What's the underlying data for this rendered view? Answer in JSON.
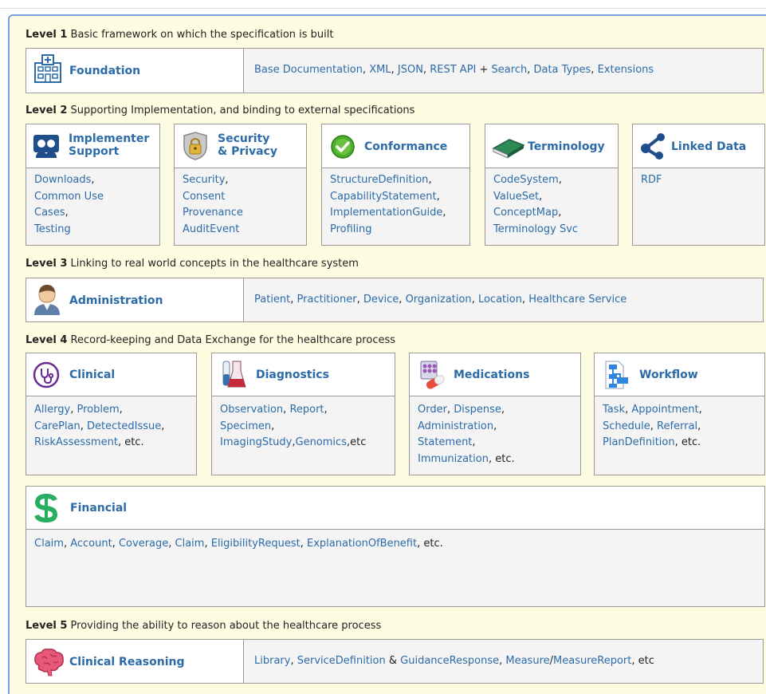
{
  "level1": {
    "num": "Level 1",
    "desc": " Basic framework on which the specification is built"
  },
  "foundation": {
    "title": "Foundation",
    "l1": "Base Documentation",
    "s1": ", ",
    "l2": "XML",
    "s2": ", ",
    "l3": "JSON",
    "s3": ", ",
    "l4": "REST API",
    "s4": " + ",
    "l5": "Search",
    "s5": ", ",
    "l6": "Data Types",
    "s6": ", ",
    "l7": "Extensions"
  },
  "level2": {
    "num": "Level 2",
    "desc": " Supporting Implementation, and binding to external specifications"
  },
  "implementer": {
    "title1": "Implementer",
    "title2": "Support",
    "l1": "Downloads",
    "s1": ",",
    "l2": "Common Use",
    "l3": "Cases",
    "s3": ",",
    "l4": "Testing"
  },
  "security": {
    "title1": "Security",
    "title2": "& Privacy",
    "l1": "Security",
    "s1": ",",
    "l2": "Consent",
    "l3": "Provenance",
    "l4": "AuditEvent"
  },
  "conformance": {
    "title": "Conformance",
    "l1": "StructureDefinition",
    "s1": ",",
    "l2": "CapabilityStatement",
    "s2": ",",
    "l3": "ImplementationGuide",
    "s3": ",",
    "l4": "Profiling"
  },
  "terminology": {
    "title": "Terminology",
    "l1": "CodeSystem",
    "s1": ",",
    "l2": "ValueSet",
    "s2": ",",
    "l3": "ConceptMap",
    "s3": ",",
    "l4": "Terminology Svc"
  },
  "linked": {
    "title": "Linked Data",
    "l1": "RDF"
  },
  "level3": {
    "num": "Level 3",
    "desc": " Linking to real world concepts in the healthcare system"
  },
  "administration": {
    "title": "Administration",
    "l1": "Patient",
    "s1": ", ",
    "l2": "Practitioner",
    "s2": ", ",
    "l3": "Device",
    "s3": ", ",
    "l4": "Organization",
    "s4": ", ",
    "l5": "Location",
    "s5": ", ",
    "l6": "Healthcare Service"
  },
  "level4": {
    "num": "Level 4",
    "desc": " Record-keeping and Data Exchange for the healthcare process"
  },
  "clinical": {
    "title": "Clinical",
    "l1": "Allergy",
    "s1": ", ",
    "l2": "Problem",
    "s2": ",",
    "l3": "CarePlan",
    "s3": ", ",
    "l4": "DetectedIssue",
    "s4": ",",
    "l5": "RiskAssessment",
    "s5": ", etc."
  },
  "diagnostics": {
    "title": "Diagnostics",
    "l1": "Observation",
    "s1": ", ",
    "l2": "Report",
    "s2": ",",
    "l3": "Specimen",
    "s3": ",",
    "l4": "ImagingStudy",
    "s4": ",",
    "l5": "Genomics",
    "s5": ",etc"
  },
  "medications": {
    "title": "Medications",
    "l1": "Order",
    "s1": ", ",
    "l2": "Dispense",
    "s2": ",",
    "l3": "Administration",
    "s3": ",",
    "l4": "Statement",
    "s4": ",",
    "l5": "Immunization",
    "s5": ", etc."
  },
  "workflow": {
    "title": "Workflow",
    "l1": "Task",
    "s1": ", ",
    "l2": "Appointment",
    "s2": ",",
    "l3": "Schedule",
    "s3": ", ",
    "l4": "Referral",
    "s4": ",",
    "l5": "PlanDefinition",
    "s5": ", etc."
  },
  "financial": {
    "title": "Financial",
    "l1": "Claim",
    "s1": ", ",
    "l2": "Account",
    "s2": ", ",
    "l3": "Coverage",
    "s3": ", ",
    "l4": "Claim",
    "s4": ", ",
    "l5": "EligibilityRequest",
    "s5": ", ",
    "l6": "ExplanationOfBenefit",
    "s6": ", etc."
  },
  "level5": {
    "num": "Level 5",
    "desc": " Providing the ability to reason about the healthcare process"
  },
  "reasoning": {
    "title": "Clinical Reasoning",
    "l1": "Library",
    "s1": ", ",
    "l2": "ServiceDefinition",
    "s2": " & ",
    "l3": "GuidanceResponse",
    "s3": ", ",
    "l4": "Measure",
    "s4": "/",
    "l5": "MeasureReport",
    "s5": ", etc"
  },
  "colors": {
    "frame_border": "#7d9ee0",
    "frame_bg": "#fefde2",
    "link": "#2c6ba8",
    "box_bg": "#f4f4f4"
  }
}
